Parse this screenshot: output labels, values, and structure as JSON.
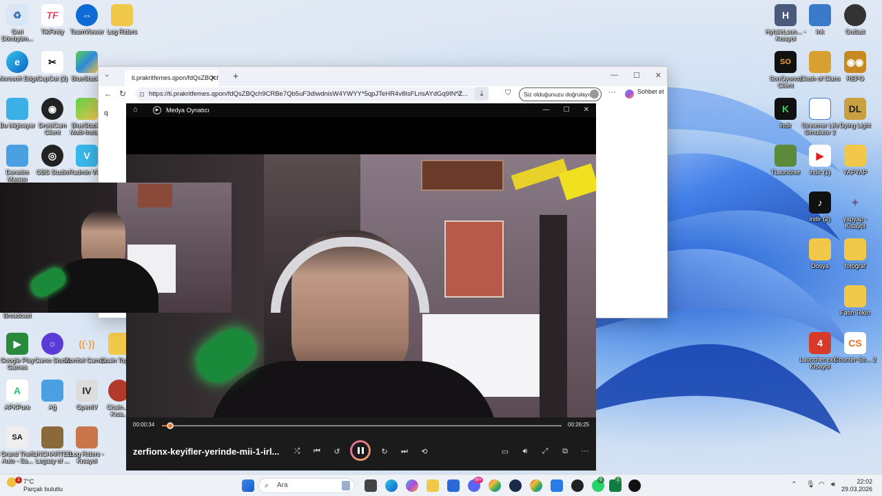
{
  "desktop": {
    "left_icons": [
      {
        "label": "Geri Dönüşüm..."
      },
      {
        "label": "TikFinity"
      },
      {
        "label": "TeamViewer"
      },
      {
        "label": "Log Riders"
      },
      {
        "label": "Microsoft Edge"
      },
      {
        "label": "CapCut (2)"
      },
      {
        "label": "BlueStacks"
      },
      {
        "label": "Bu bilgisayar"
      },
      {
        "label": "DroidCam Client"
      },
      {
        "label": "BlueStacks Multi-Insta..."
      },
      {
        "label": "Denetim Masası"
      },
      {
        "label": "OBS Studio"
      },
      {
        "label": "Radmin VPN"
      },
      {
        "label": "Broadcast"
      },
      {
        "label": "Google Play Games"
      },
      {
        "label": "Camo Studio"
      },
      {
        "label": "Konftel Came..."
      },
      {
        "label": "Chain Toget..."
      },
      {
        "label": "APKPure"
      },
      {
        "label": "Ağ"
      },
      {
        "label": "OpenIV"
      },
      {
        "label": "Chain... - Kısa..."
      },
      {
        "label": "Grand Theft Auto - Sa..."
      },
      {
        "label": "UNCHARTED Legacy of ..."
      },
      {
        "label": "Log Riders - Kısayol"
      }
    ],
    "right_icons": [
      {
        "label": "HytaleLaun... - Kısayol"
      },
      {
        "label": "Ink"
      },
      {
        "label": "Outlast"
      },
      {
        "label": "SonOyuncu Client"
      },
      {
        "label": "Clash of Clans"
      },
      {
        "label": "REPO"
      },
      {
        "label": "indir"
      },
      {
        "label": "Streamer Life Simulator 2"
      },
      {
        "label": "Dying Light"
      },
      {
        "label": "TLauncher"
      },
      {
        "label": "indir (1)"
      },
      {
        "label": "YAPYAP"
      },
      {
        "label": "indir (2)"
      },
      {
        "label": "yapyap - Kısayol"
      },
      {
        "label": "Dosya"
      },
      {
        "label": "fotoğraf"
      },
      {
        "label": "Fatih Tekin"
      },
      {
        "label": "Launcher.exe - Kısayol"
      },
      {
        "label": "Counter-Str... 2"
      }
    ]
  },
  "browser": {
    "tab_title": "ti.prakritfemes.qpon/fdQsZBQch...",
    "new_tab": "+",
    "url": "https://ti.prakritfemes.qpon/fdQsZBQch9CRBe7Qb5uF3dIwdnisW4YWYY*5qpJTeHR4v8IsFLrisAYdGq9IN*Z...",
    "verify_button": "Siz olduğunuzu doğrulayın",
    "copilot_label": "Sohbet et",
    "page_char": "q"
  },
  "player": {
    "app_title": "Medya Oynatıcı",
    "time_elapsed": "00:00:34",
    "time_total": "00:26:25",
    "progress": 0.0215,
    "video_title": "zerfionx-keyifler-yerinde-mii-1-irl..."
  },
  "taskbar": {
    "weather_temp": "7°C",
    "weather_desc": "Parçalı bulutlu",
    "weather_badge": "1",
    "search_placeholder": "Ara",
    "clock_time": "22:02",
    "clock_date": "29.03.2026",
    "badges": [
      "99+",
      "6",
      "1"
    ]
  },
  "colors": {
    "accent": "#e67a2e",
    "player_bg": "#1b1b1b",
    "taskbar_bg": "#eef1f6"
  }
}
